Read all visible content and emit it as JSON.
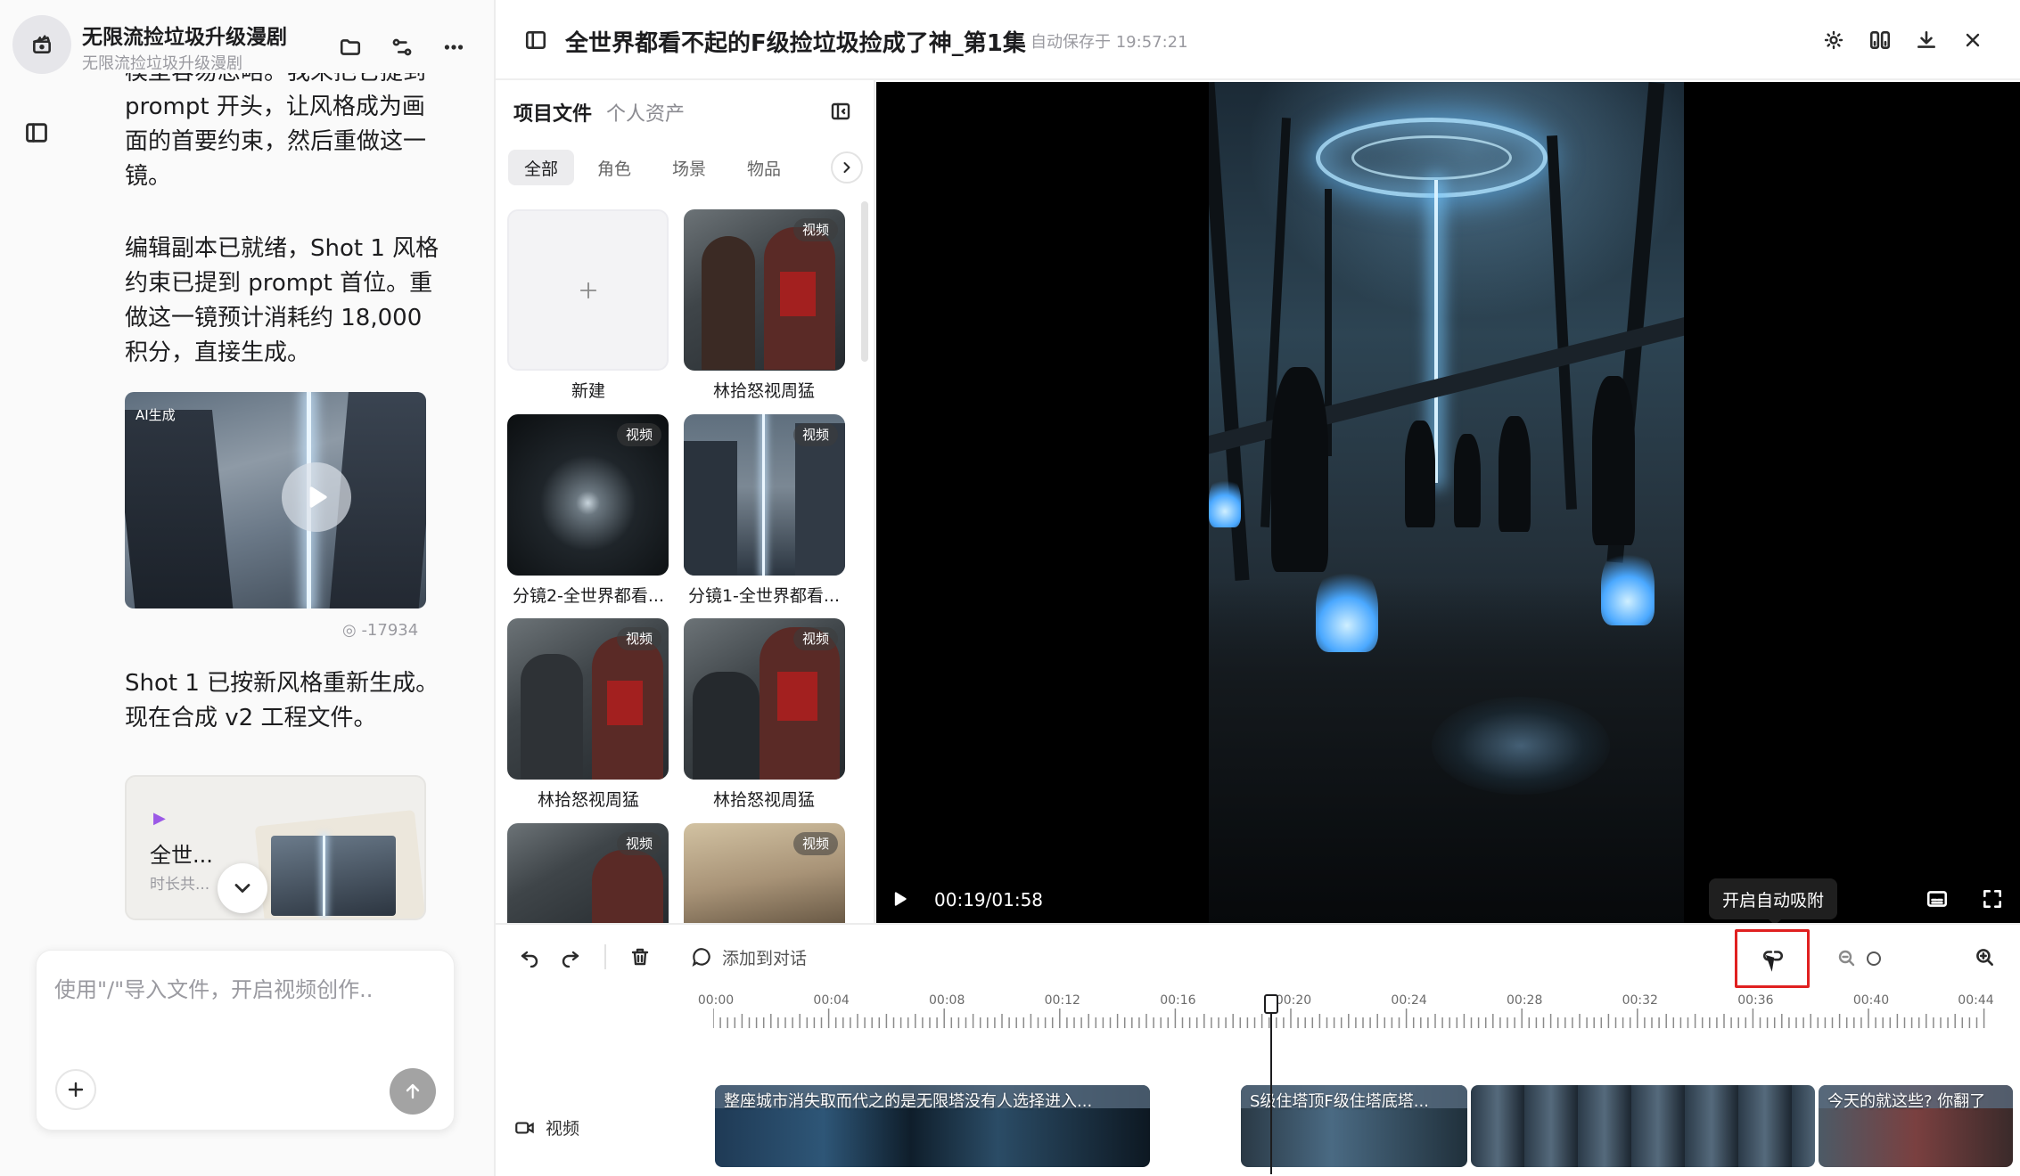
{
  "project": {
    "name": "无限流捡垃圾升级漫剧",
    "subtitle": "无限流捡垃圾升级漫剧"
  },
  "chat": {
    "msg_top": "模型容易忽略。我来把它提到 prompt 开头，让风格成为画面的首要约束，然后重做这一镜。",
    "msg_mid": "编辑副本已就绪，Shot 1 风格约束已提到 prompt 首位。重做这一镜预计消耗约 18,000 积分，直接生成。",
    "ai_tag": "AI生成",
    "cost": "-17934",
    "msg_bottom": "Shot 1 已按新风格重新生成。现在合成 v2 工程文件。",
    "file_card": {
      "title": "全世...",
      "meta": "时长共..."
    },
    "input_placeholder": "使用\"/\"导入文件，开启视频创作.."
  },
  "assets": {
    "tabs": [
      "项目文件",
      "个人资产"
    ],
    "filters": [
      "全部",
      "角色",
      "场景",
      "物品"
    ],
    "badge": "视频",
    "new_label": "新建",
    "tiles": [
      {
        "label": "林拾怒视周猛"
      },
      {
        "label": "分镜2-全世界都看..."
      },
      {
        "label": "分镜1-全世界都看..."
      },
      {
        "label": "林拾怒视周猛"
      },
      {
        "label": "林拾怒视周猛"
      },
      {
        "label": ""
      },
      {
        "label": ""
      }
    ]
  },
  "header": {
    "title": "全世界都看不起的F级捡垃圾捡成了神_第1集",
    "autosave": "自动保存于 19:57:21"
  },
  "player": {
    "time": "00:19/01:58",
    "progress": 0.161
  },
  "tooltip": {
    "text": "开启自动吸附"
  },
  "toolbar": {
    "add_to_chat": "添加到对话"
  },
  "timeline": {
    "ticks": [
      "00:00",
      "00:04",
      "00:08",
      "00:12",
      "00:16",
      "00:20",
      "00:24",
      "00:28",
      "00:32",
      "00:36",
      "00:40",
      "00:44"
    ],
    "track_label": "视频",
    "clips": [
      {
        "caption": "整座城市消失取而代之的是无限塔没有人选择进入..."
      },
      {
        "caption": "S级住塔顶F级住塔底塔..."
      },
      {
        "caption": ""
      },
      {
        "caption": "今天的就这些? 你翻了"
      }
    ]
  },
  "colors": {
    "highlight": "#e02020",
    "tooltip_bg": "#1f1f1f",
    "send_button": "#a3a3a3"
  }
}
